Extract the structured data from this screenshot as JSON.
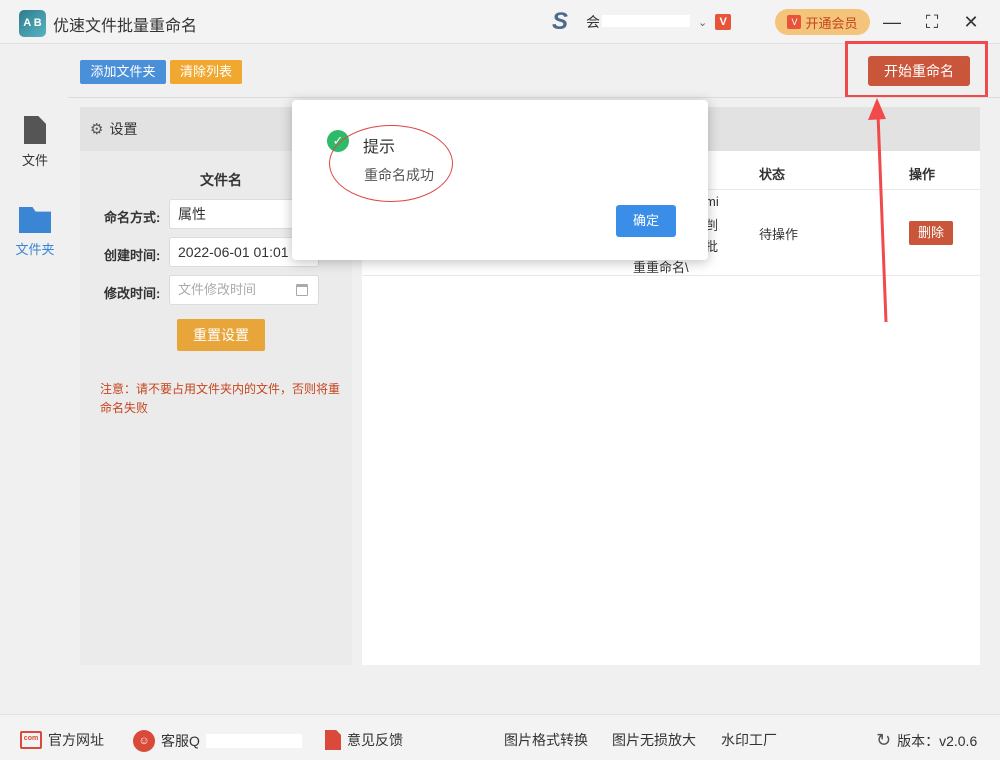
{
  "titlebar": {
    "app_title": "优速文件批量重命名",
    "logo_text": "A B",
    "user_prefix": "会",
    "vip_label": "开通会员",
    "v_badge": "V",
    "minimize": "—",
    "maximize": "⛶",
    "close": "✕"
  },
  "toolbar": {
    "add_folder": "添加文件夹",
    "clear_list": "清除列表",
    "start_rename": "开始重命名"
  },
  "sidebar": {
    "items": [
      {
        "label": "文件",
        "active": false
      },
      {
        "label": "文件夹",
        "active": true
      }
    ]
  },
  "settings": {
    "header": "设置",
    "section_title": "文件名",
    "naming_label": "命名方式:",
    "naming_value": "属性",
    "created_label": "创建时间:",
    "created_value": "2022-06-01 01:01",
    "modified_label": "修改时间:",
    "modified_placeholder": "文件修改时间",
    "reset_button": "重置设置",
    "note": "注意：请不要占用文件夹内的文件，否则将重命名失败"
  },
  "file_list": {
    "columns": [
      "状态",
      "操作"
    ],
    "rows": [
      {
        "name_fragments": [
          "mi",
          "剀",
          "批",
          "重重命名\\"
        ],
        "status": "待操作",
        "action": "删除"
      }
    ]
  },
  "modal": {
    "title": "提示",
    "message": "重命名成功",
    "ok_button": "确定",
    "check": "✓"
  },
  "bottombar": {
    "website": "官方网址",
    "com_icon_text": "com",
    "service": "客服Q",
    "feedback": "意见反馈",
    "format_convert": "图片格式转换",
    "lossless_enlarge": "图片无损放大",
    "watermark": "水印工厂",
    "version": "版本：v2.0.6"
  },
  "colors": {
    "primary_blue": "#4a90d9",
    "orange": "#f0a830",
    "start_red": "#c9553a",
    "annotation_red": "#f04a4a",
    "success_green": "#2dbb6a"
  }
}
